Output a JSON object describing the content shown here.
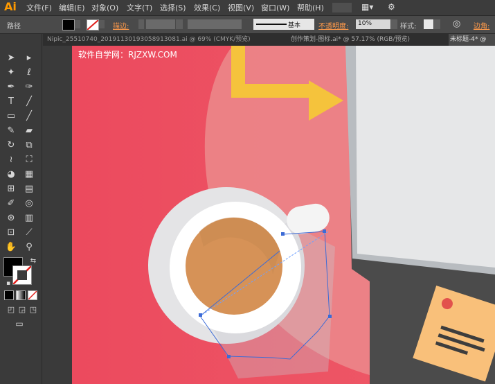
{
  "app": {
    "logo": "Ai"
  },
  "menu": [
    "文件(F)",
    "编辑(E)",
    "对象(O)",
    "文字(T)",
    "选择(S)",
    "效果(C)",
    "视图(V)",
    "窗口(W)",
    "帮助(H)"
  ],
  "control": {
    "selection_label": "路径",
    "stroke_label": "描边:",
    "stroke_style": "基本",
    "opacity_label": "不透明度:",
    "opacity_value": "10%",
    "style_label": "样式:",
    "corner_label": "边角:"
  },
  "tabs": [
    "Nipic_25510740_20191130193058913081.ai @ 69% (CMYK/预览)",
    "创作策划-图标.ai* @ 57.17% (RGB/预览)",
    "未标题-4* @"
  ],
  "watermark": "软件自学网：RJZXW.COM",
  "colors": {
    "canvas_bg": "#ee4d60",
    "arrow": "#f5c33c",
    "coffee": "#d69257",
    "note": "#f9c07a",
    "accent": "#ff9a00"
  }
}
